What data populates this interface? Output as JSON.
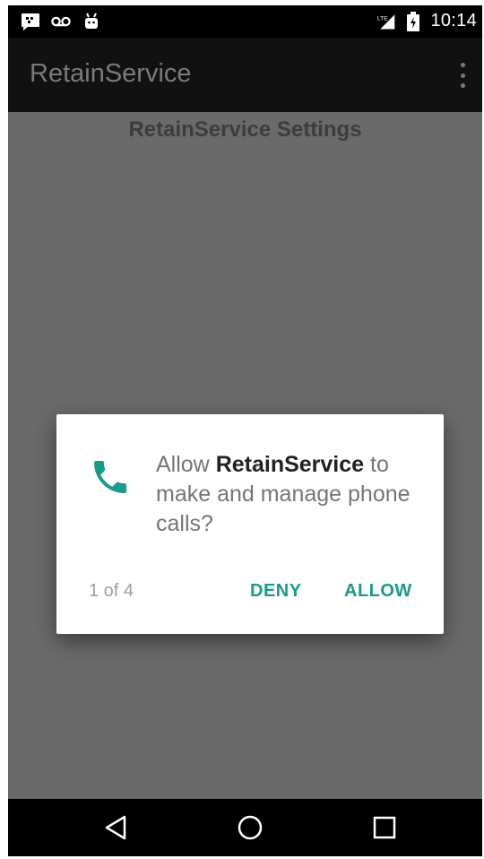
{
  "status_bar": {
    "time": "10:14",
    "left_icons": [
      "message-icon",
      "voicemail-icon",
      "android-icon"
    ],
    "right_icons": [
      "signal-icon",
      "battery-icon"
    ]
  },
  "app_bar": {
    "title": "RetainService",
    "overflow_icon": "more-vert-icon"
  },
  "main": {
    "heading": "RetainService Settings"
  },
  "dialog": {
    "icon": "phone-icon",
    "message_prefix": "Allow ",
    "app_name": "RetainService",
    "message_suffix": " to make and manage phone calls?",
    "counter": "1 of 4",
    "deny_label": "DENY",
    "allow_label": "ALLOW"
  },
  "nav_bar": {
    "back_icon": "back-icon",
    "home_icon": "home-icon",
    "recents_icon": "recents-icon"
  },
  "colors": {
    "accent": "#1a9a8a",
    "scrim": "#6a6a6a",
    "app_bar": "#111111"
  }
}
